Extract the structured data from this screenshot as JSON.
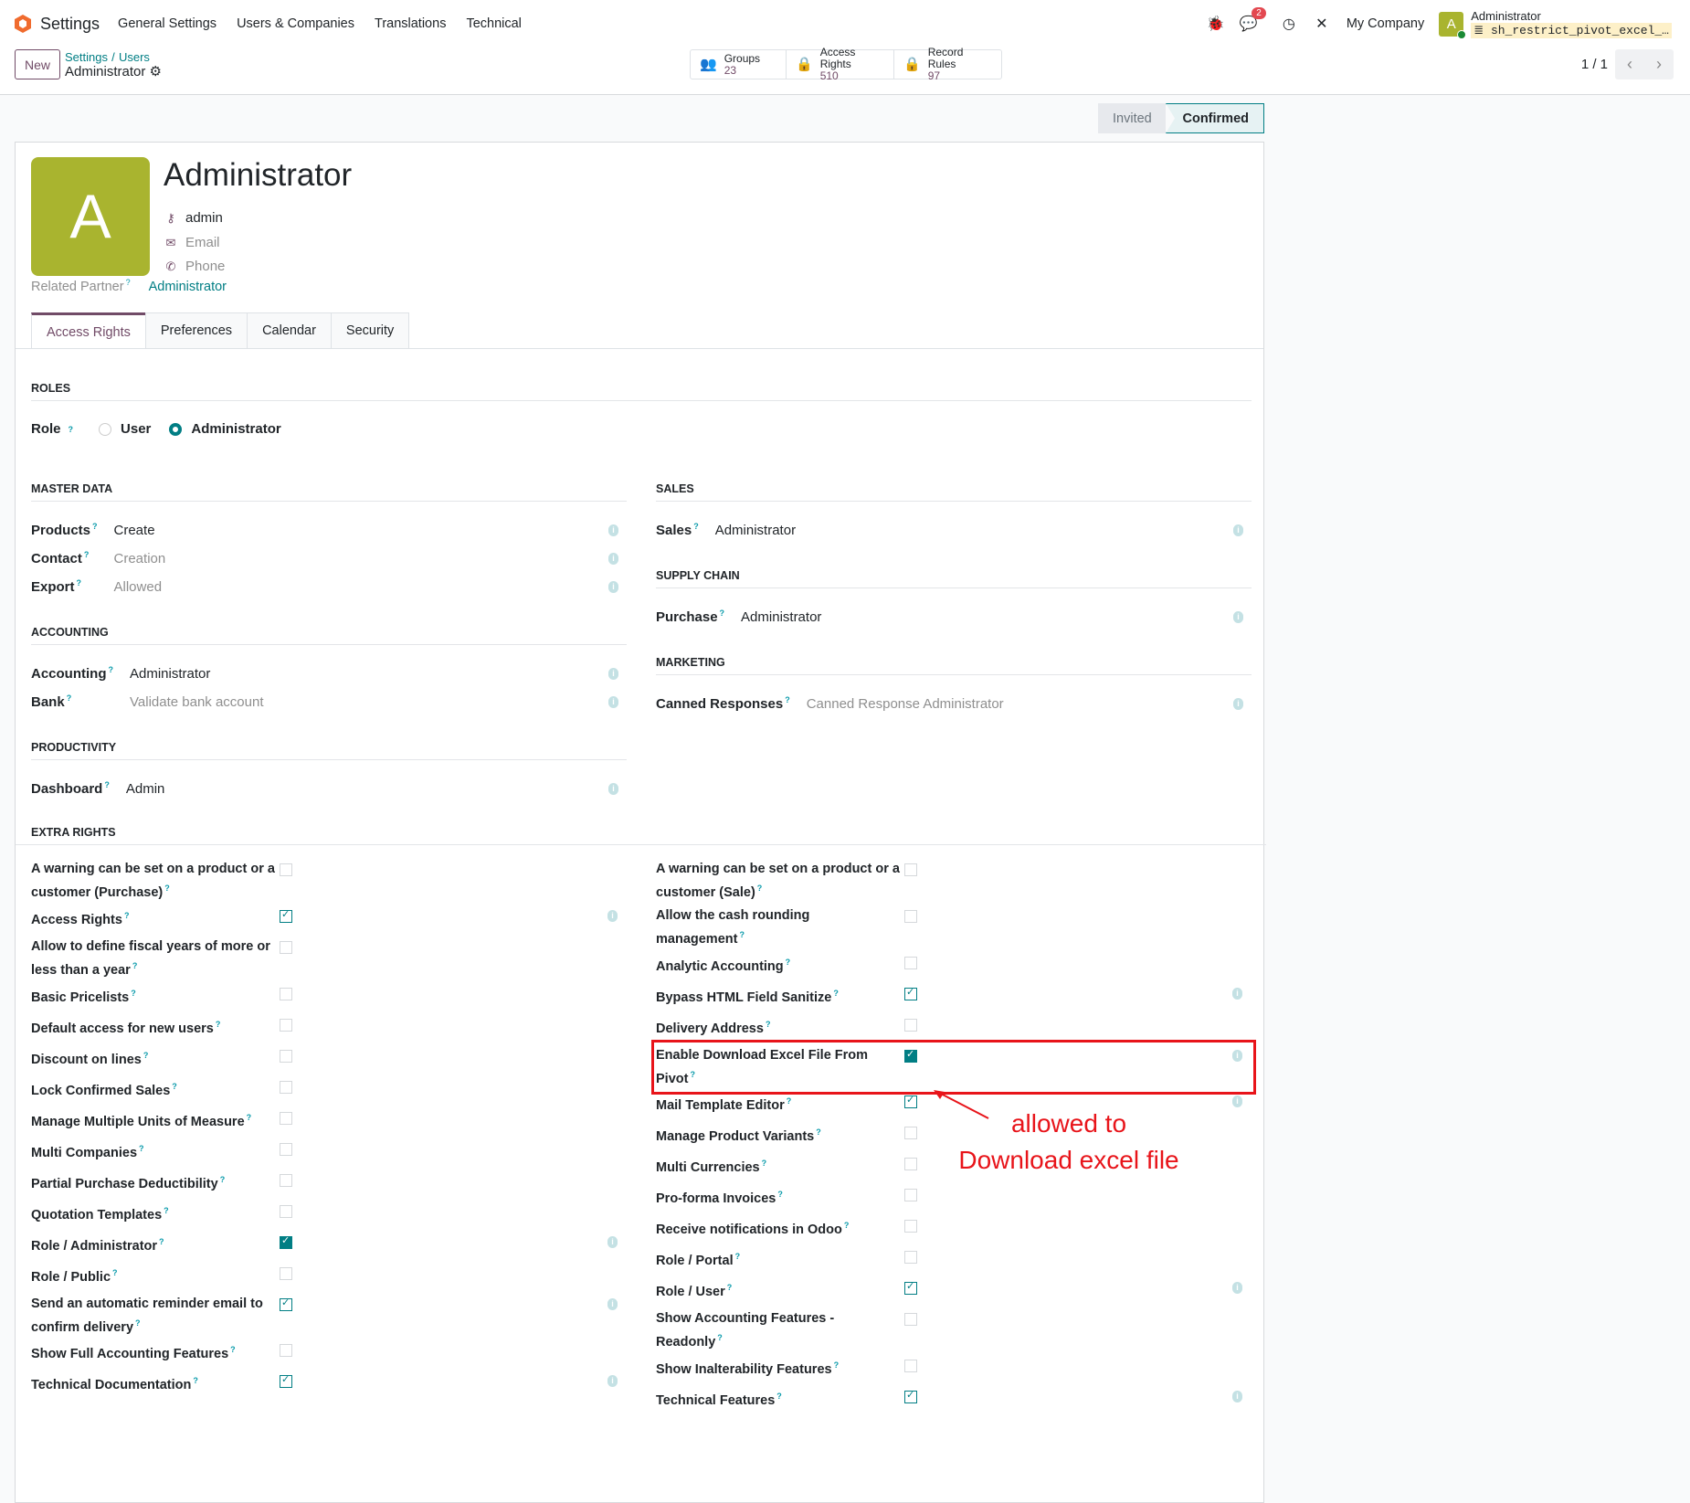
{
  "nav": {
    "app": "Settings",
    "menu": [
      "General Settings",
      "Users & Companies",
      "Translations",
      "Technical"
    ],
    "chat_badge": "2",
    "company": "My Company",
    "user_initial": "A",
    "user_name": "Administrator",
    "db": "sh_restrict_pivot_excel_…"
  },
  "control": {
    "new_label": "New",
    "breadcrumb": [
      "Settings",
      "Users"
    ],
    "separator": "/",
    "current": "Administrator",
    "stats": [
      {
        "label": "Groups",
        "value": "23",
        "icon": "users-icon"
      },
      {
        "label": "Access Rights",
        "value": "510",
        "icon": "lock-icon"
      },
      {
        "label": "Record Rules",
        "value": "97",
        "icon": "lock-icon"
      }
    ],
    "pager": "1 / 1"
  },
  "status": {
    "steps": [
      "Invited",
      "Confirmed"
    ],
    "current": "Confirmed"
  },
  "user": {
    "initial": "A",
    "name": "Administrator",
    "login": "admin",
    "email_placeholder": "Email",
    "phone_placeholder": "Phone",
    "partner_label": "Related Partner",
    "partner_value": "Administrator"
  },
  "tabs": [
    "Access Rights",
    "Preferences",
    "Calendar",
    "Security"
  ],
  "roles": {
    "heading": "ROLES",
    "label": "Role",
    "options": [
      "User",
      "Administrator"
    ],
    "selected": "Administrator"
  },
  "left_groups": [
    {
      "heading": "MASTER DATA",
      "fields": [
        {
          "label": "Products",
          "value": "Create",
          "muted": false
        },
        {
          "label": "Contact",
          "value": "Creation",
          "muted": true
        },
        {
          "label": "Export",
          "value": "Allowed",
          "muted": true
        }
      ]
    },
    {
      "heading": "ACCOUNTING",
      "fields": [
        {
          "label": "Accounting",
          "value": "Administrator",
          "muted": false
        },
        {
          "label": "Bank",
          "value": "Validate bank account",
          "muted": true
        }
      ]
    },
    {
      "heading": "PRODUCTIVITY",
      "fields": [
        {
          "label": "Dashboard",
          "value": "Admin",
          "muted": false
        }
      ]
    }
  ],
  "right_groups": [
    {
      "heading": "SALES",
      "fields": [
        {
          "label": "Sales",
          "value": "Administrator",
          "muted": false
        }
      ]
    },
    {
      "heading": "SUPPLY CHAIN",
      "fields": [
        {
          "label": "Purchase",
          "value": "Administrator",
          "muted": false
        }
      ]
    },
    {
      "heading": "MARKETING",
      "fields": [
        {
          "label": "Canned Responses",
          "value": "Canned Response Administrator",
          "muted": true
        }
      ]
    }
  ],
  "extra": {
    "heading": "EXTRA RIGHTS",
    "left": [
      {
        "label": "A warning can be set on a product or a customer (Purchase)",
        "checked": false
      },
      {
        "label": "Access Rights",
        "checked": true
      },
      {
        "label": "Allow to define fiscal years of more or less than a year",
        "checked": false
      },
      {
        "label": "Basic Pricelists",
        "checked": false
      },
      {
        "label": "Default access for new users",
        "checked": false
      },
      {
        "label": "Discount on lines",
        "checked": false
      },
      {
        "label": "Lock Confirmed Sales",
        "checked": false
      },
      {
        "label": "Manage Multiple Units of Measure",
        "checked": false
      },
      {
        "label": "Multi Companies",
        "checked": false
      },
      {
        "label": "Partial Purchase Deductibility",
        "checked": false
      },
      {
        "label": "Quotation Templates",
        "checked": false
      },
      {
        "label": "Role / Administrator",
        "checked": true,
        "filled": true
      },
      {
        "label": "Role / Public",
        "checked": false
      },
      {
        "label": "Send an automatic reminder email to confirm delivery",
        "checked": true
      },
      {
        "label": "Show Full Accounting Features",
        "checked": false
      },
      {
        "label": "Technical Documentation",
        "checked": true
      }
    ],
    "right": [
      {
        "label": "A warning can be set on a product or a customer (Sale)",
        "checked": false
      },
      {
        "label": "Allow the cash rounding management",
        "checked": false
      },
      {
        "label": "Analytic Accounting",
        "checked": false
      },
      {
        "label": "Bypass HTML Field Sanitize",
        "checked": true
      },
      {
        "label": "Delivery Address",
        "checked": false
      },
      {
        "label": "Enable Download Excel File From Pivot",
        "checked": true,
        "filled": true,
        "highlighted": true
      },
      {
        "label": "Mail Template Editor",
        "checked": true
      },
      {
        "label": "Manage Product Variants",
        "checked": false
      },
      {
        "label": "Multi Currencies",
        "checked": false
      },
      {
        "label": "Pro-forma Invoices",
        "checked": false
      },
      {
        "label": "Receive notifications in Odoo",
        "checked": false
      },
      {
        "label": "Role / Portal",
        "checked": false
      },
      {
        "label": "Role / User",
        "checked": true
      },
      {
        "label": "Show Accounting Features - Readonly",
        "checked": false
      },
      {
        "label": "Show Inalterability Features",
        "checked": false
      },
      {
        "label": "Technical Features",
        "checked": true
      }
    ]
  },
  "annotation": {
    "line1": "allowed to",
    "line2": "Download excel file",
    "color": "#e8141a"
  },
  "colors": {
    "brand": "#714b67",
    "accent": "#017e84",
    "avatar": "#a9b42f"
  }
}
